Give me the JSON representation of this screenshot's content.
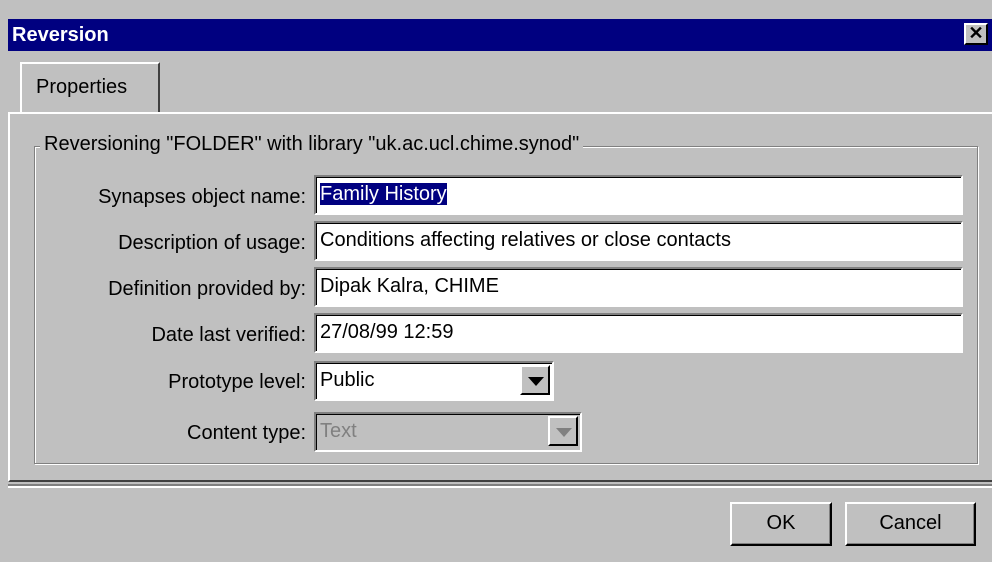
{
  "window": {
    "title": "Reversion",
    "close_symbol": "✕"
  },
  "tabs": [
    {
      "label": "Properties",
      "active": true
    }
  ],
  "group": {
    "legend": "Reversioning \"FOLDER\" with library \"uk.ac.ucl.chime.synod\""
  },
  "fields": [
    {
      "label": "Synapses object name:",
      "value": "Family History",
      "selected": true
    },
    {
      "label": "Description of usage:",
      "value": "Conditions affecting relatives or close contacts"
    },
    {
      "label": "Definition provided by:",
      "value": "Dipak Kalra, CHIME"
    },
    {
      "label": "Date last verified:",
      "value": "27/08/99 12:59"
    }
  ],
  "prototype": {
    "label": "Prototype level:",
    "value": "Public"
  },
  "content": {
    "label": "Content type:",
    "value": "Text",
    "disabled": true
  },
  "buttons": {
    "ok": "OK",
    "cancel": "Cancel"
  },
  "colors": {
    "titlebar": "#000080",
    "face": "#c0c0c0",
    "selection": "#000080"
  }
}
